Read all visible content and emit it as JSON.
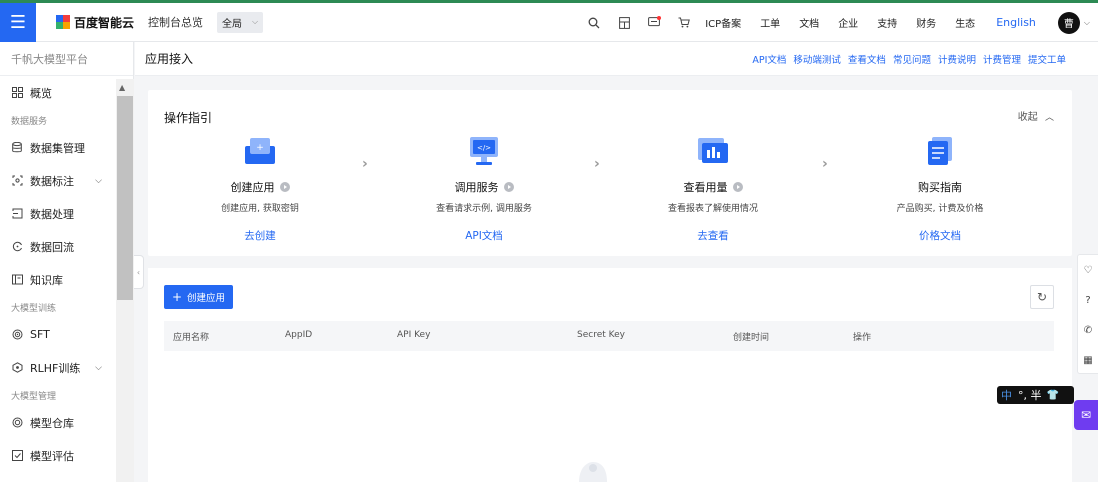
{
  "topbar": {
    "menu_icon": "hamburger-icon",
    "logo_text": "百度智能云",
    "console_link": "控制台总览",
    "region": "全局",
    "icons": [
      "search-icon",
      "grid-doc-icon",
      "message-icon",
      "cart-icon"
    ],
    "links": [
      "ICP备案",
      "工单",
      "文档",
      "企业",
      "支持",
      "财务",
      "生态"
    ],
    "language": "English",
    "avatar_initial": "曹"
  },
  "sidebar": {
    "platform_title": "千帆大模型平台",
    "overview": "概览",
    "group_data": "数据服务",
    "items_data": [
      {
        "label": "数据集管理",
        "icon": "database-icon",
        "expandable": false
      },
      {
        "label": "数据标注",
        "icon": "tag-icon",
        "expandable": true
      },
      {
        "label": "数据处理",
        "icon": "process-icon",
        "expandable": false
      },
      {
        "label": "数据回流",
        "icon": "reflow-icon",
        "expandable": false
      },
      {
        "label": "知识库",
        "icon": "book-icon",
        "expandable": false
      }
    ],
    "group_train": "大模型训练",
    "items_train": [
      {
        "label": "SFT",
        "icon": "target-icon",
        "expandable": false
      },
      {
        "label": "RLHF训练",
        "icon": "rlhf-icon",
        "expandable": true
      }
    ],
    "group_manage": "大模型管理",
    "items_manage": [
      {
        "label": "模型仓库",
        "icon": "repository-icon",
        "expandable": false
      },
      {
        "label": "模型评估",
        "icon": "evaluate-icon",
        "expandable": false
      }
    ]
  },
  "page": {
    "title": "应用接入",
    "links": [
      "API文档",
      "移动端测试",
      "查看文档",
      "常见问题",
      "计费说明",
      "计费管理",
      "提交工单"
    ]
  },
  "guide": {
    "title": "操作指引",
    "collapse_label": "收起",
    "steps": [
      {
        "name": "创建应用",
        "desc": "创建应用, 获取密钥",
        "link": "去创建"
      },
      {
        "name": "调用服务",
        "desc": "查看请求示例, 调用服务",
        "link": "API文档"
      },
      {
        "name": "查看用量",
        "desc": "查看报表了解使用情况",
        "link": "去查看"
      },
      {
        "name": "购买指南",
        "desc": "产品购买, 计费及价格",
        "link": "价格文档"
      }
    ]
  },
  "apps": {
    "create_button": "创建应用",
    "columns": [
      "应用名称",
      "AppID",
      "API Key",
      "Secret Key",
      "创建时间",
      "操作"
    ]
  },
  "ime": {
    "mode": "中",
    "text": "°, 半"
  },
  "colors": {
    "primary": "#2468f2",
    "chat": "#6f3cf0"
  }
}
